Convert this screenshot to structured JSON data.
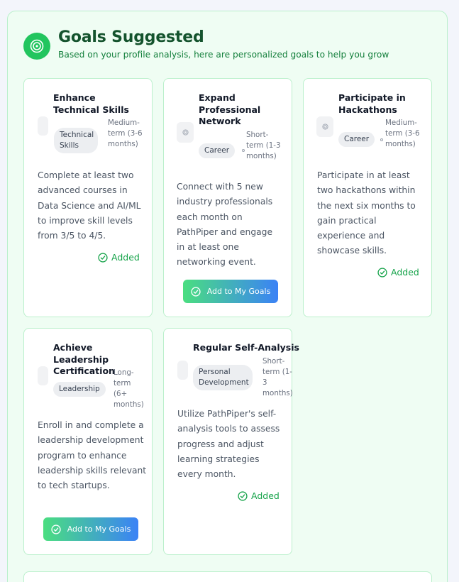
{
  "header": {
    "title": "Goals Suggested",
    "subtitle": "Based on your profile analysis, here are personalized goals to help you grow",
    "icon": "target-icon",
    "accent": "#22c55e"
  },
  "goals": [
    {
      "title": "Enhance Technical Skills",
      "category": "Technical Skills",
      "term": "Medium-term (3-6 months)",
      "description": "Complete at least two advanced courses in Data Science and AI/ML to improve skill levels from 3/5 to 4/5.",
      "status": "Added"
    },
    {
      "title": "Expand Professional Network",
      "category": "Career",
      "term": "Short-term (1-3 months)",
      "description": "Connect with 5 new industry professionals each month on PathPiper and engage in at least one networking event.",
      "action": "Add to My Goals"
    },
    {
      "title": "Participate in Hackathons",
      "category": "Career",
      "term": "Medium-term (3-6 months)",
      "description": "Participate in at least two hackathons within the next six months to gain practical experience and showcase skills.",
      "status": "Added"
    },
    {
      "title": "Achieve Leadership Certification",
      "category": "Leadership",
      "term": "Long-term (6+ months)",
      "description": "Enroll in and complete a leadership development program to enhance leadership skills relevant to tech startups.",
      "action": "Add to My Goals"
    },
    {
      "title": "Regular Self-Analysis",
      "category": "Personal Development",
      "term": "Short-term (1-3 months)",
      "description": "Utilize PathPiper's self-analysis tools to assess progress and adjust learning strategies every month.",
      "status": "Added"
    }
  ]
}
